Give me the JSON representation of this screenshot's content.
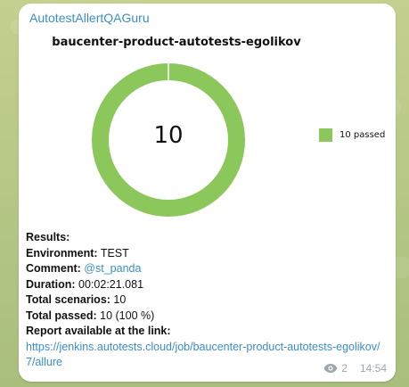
{
  "message": {
    "sender": "AutotestAllertQAGuru",
    "views": "2",
    "time": "14:54"
  },
  "report": {
    "project_title": "baucenter-product-autotests-egolikov",
    "center_count": "10",
    "legend_label": "10 passed",
    "colors": {
      "passed": "#8bc75a"
    }
  },
  "chart_data": {
    "type": "pie",
    "title": "baucenter-product-autotests-egolikov",
    "slices": [
      {
        "label": "10 passed",
        "value": 10,
        "color": "#8bc75a"
      }
    ],
    "legend": "right"
  },
  "results": {
    "heading": "Results:",
    "environment_label": "Environment:",
    "environment_value": "TEST",
    "comment_label": "Comment:",
    "comment_value": "@st_panda",
    "duration_label": "Duration:",
    "duration_value": "00:02:21.081",
    "total_scenarios_label": "Total scenarios:",
    "total_scenarios_value": "10",
    "total_passed_label": "Total passed:",
    "total_passed_value": "10 (100 %)",
    "report_label": "Report available at the link:",
    "report_url": "https://jenkins.autotests.cloud/job/baucenter-product-autotests-egolikov/7/allure"
  }
}
